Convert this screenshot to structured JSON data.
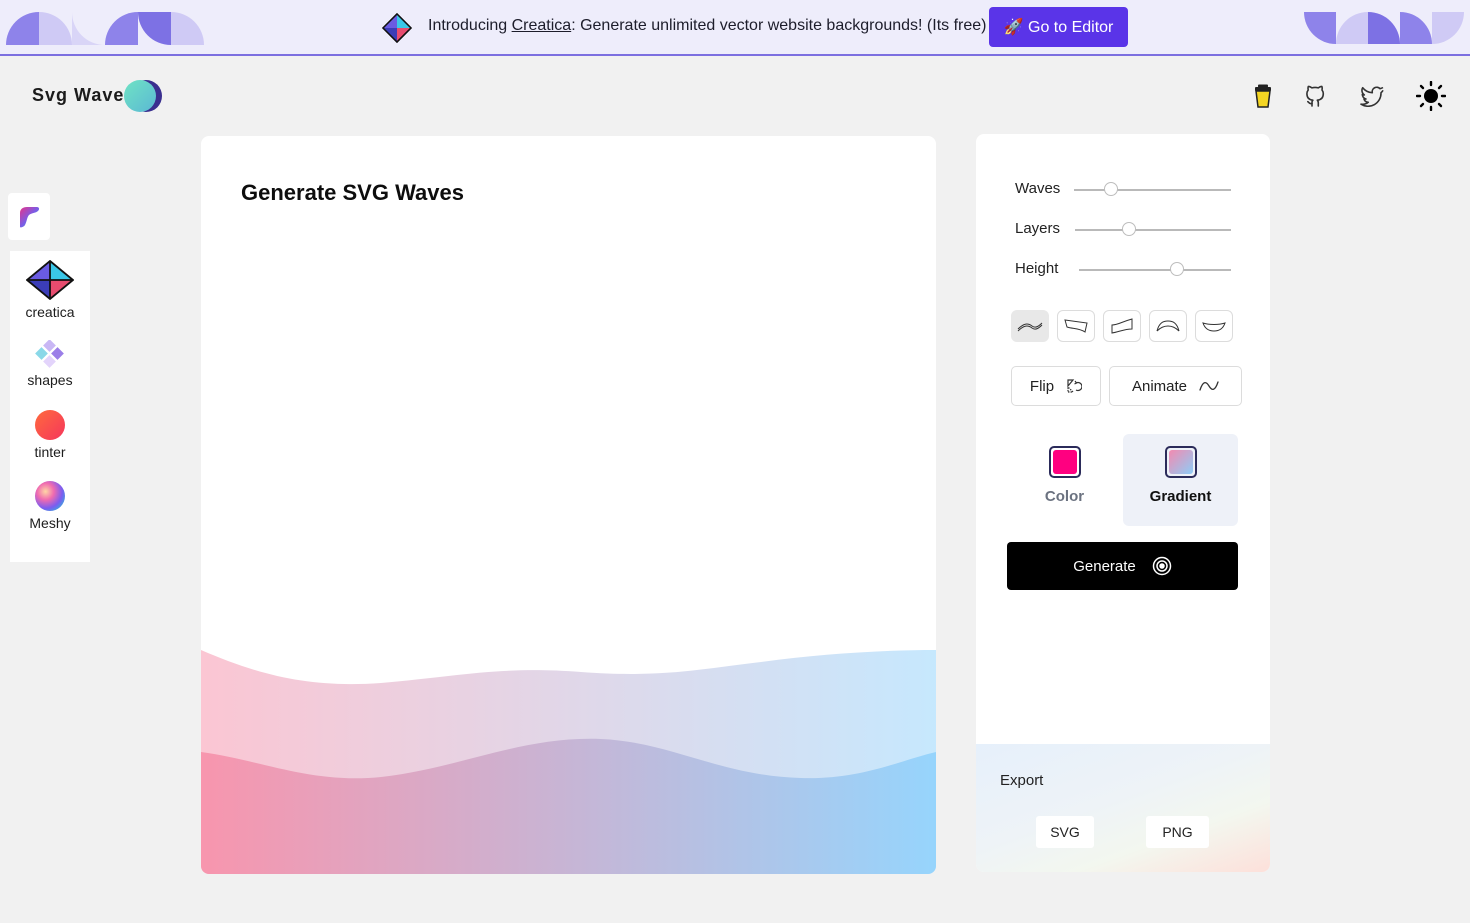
{
  "banner": {
    "text_before": "Introducing ",
    "link_text": "Creatica",
    "text_after": ": Generate unlimited vector website backgrounds! (Its free)",
    "button_label": "🚀 Go to Editor"
  },
  "header": {
    "brand": "Svg Wave",
    "icons": [
      "coffee-cup-icon",
      "github-icon",
      "twitter-icon",
      "sun-icon"
    ]
  },
  "sidebar": {
    "items": [
      {
        "label": "creatica",
        "icon": "creatica-logo-icon"
      },
      {
        "label": "shapes",
        "icon": "shapes-icon"
      },
      {
        "label": "tinter",
        "icon": "tinter-icon"
      },
      {
        "label": "Meshy",
        "icon": "meshy-icon"
      }
    ]
  },
  "preview": {
    "title": "Generate SVG Waves"
  },
  "controls": {
    "sliders": [
      {
        "label": "Waves",
        "value": 0.23
      },
      {
        "label": "Layers",
        "value": 0.35
      },
      {
        "label": "Height",
        "value": 0.65
      }
    ],
    "shapes": [
      "wave-shape-1-icon",
      "wave-shape-2-icon",
      "wave-shape-3-icon",
      "wave-shape-4-icon",
      "wave-shape-5-icon"
    ],
    "flip_label": "Flip",
    "animate_label": "Animate",
    "modes": [
      {
        "label": "Color",
        "swatch": "#ff0080"
      },
      {
        "label": "Gradient",
        "swatch_from": "#f38ab0",
        "swatch_to": "#8ecdf7"
      }
    ],
    "generate_label": "Generate"
  },
  "export": {
    "title": "Export",
    "svg_label": "SVG",
    "png_label": "PNG"
  },
  "colors": {
    "accent": "#5a34e8",
    "gradient_start": "#f78da7",
    "gradient_end": "#8ed1fc"
  }
}
